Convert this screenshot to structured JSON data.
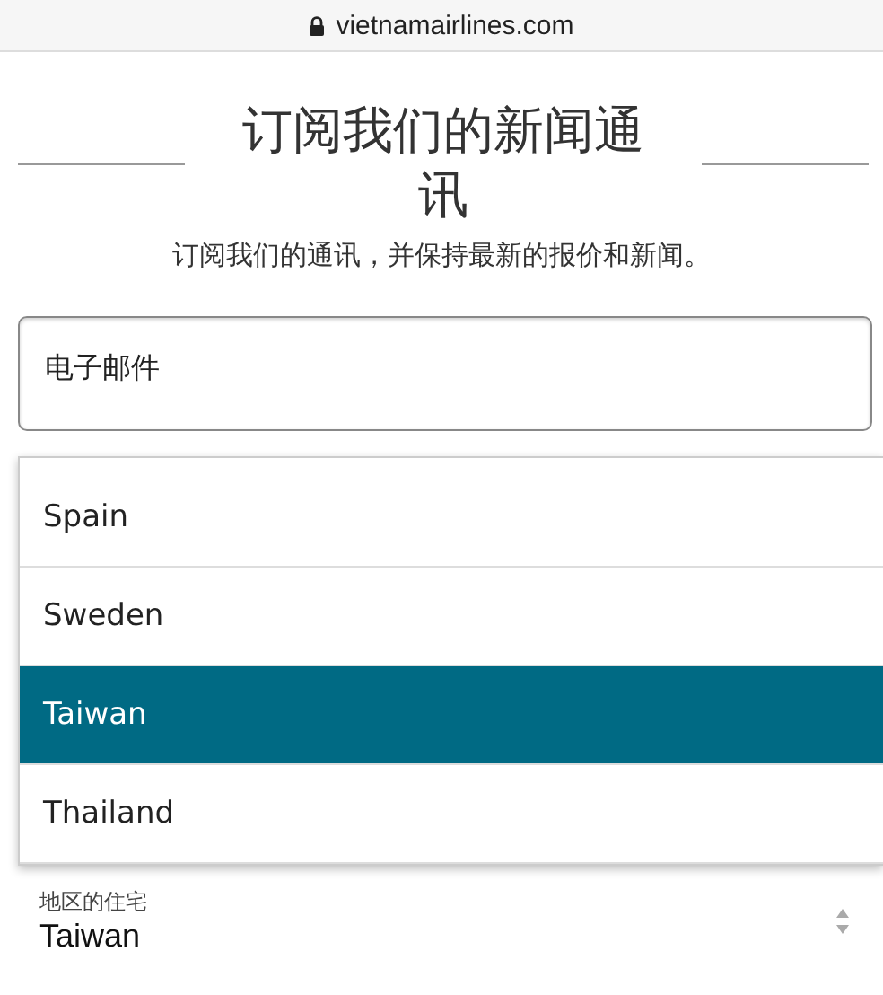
{
  "address_bar": {
    "url": "vietnamairlines.com"
  },
  "heading": {
    "title": "订阅我们的新闻通讯",
    "subtitle": "订阅我们的通讯，并保持最新的报价和新闻。"
  },
  "email_field": {
    "placeholder": "电子邮件"
  },
  "country_options": [
    {
      "label": "Spain",
      "selected": false
    },
    {
      "label": "Sweden",
      "selected": false
    },
    {
      "label": "Taiwan",
      "selected": true
    },
    {
      "label": "Thailand",
      "selected": false
    }
  ],
  "region_field": {
    "label": "地区的住宅",
    "value": "Taiwan"
  }
}
